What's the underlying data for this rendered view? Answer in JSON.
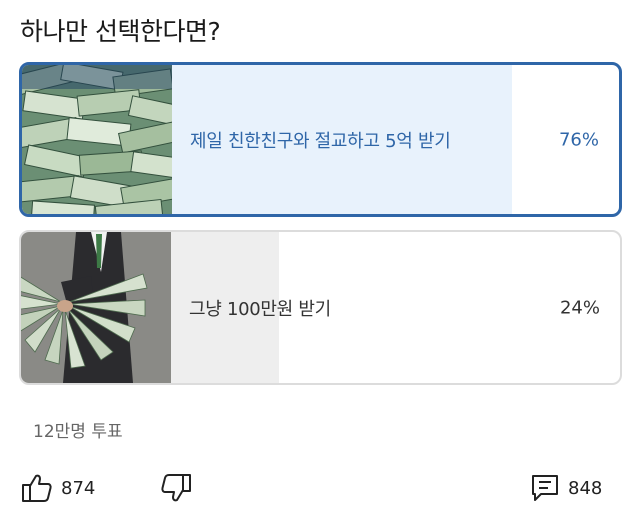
{
  "question": "하나만 선택한다면?",
  "options": [
    {
      "label": "제일 친한친구와 절교하고 5억 받기",
      "percent_text": "76%",
      "percent": 76,
      "selected": true,
      "image": "money-stacks-image"
    },
    {
      "label": "그냥 100만원 받기",
      "percent_text": "24%",
      "percent": 24,
      "selected": false,
      "image": "man-holding-dollar-fan-image"
    }
  ],
  "votes": "12만명 투표",
  "actions": {
    "like_count": "874",
    "comment_count": "848",
    "like_icon": "thumbs-up-icon",
    "dislike_icon": "thumbs-down-icon",
    "comment_icon": "comment-icon"
  },
  "colors": {
    "accent": "#2f66a8",
    "selected_fill": "#e8f2fc",
    "unselected_fill": "#eeeeee"
  }
}
